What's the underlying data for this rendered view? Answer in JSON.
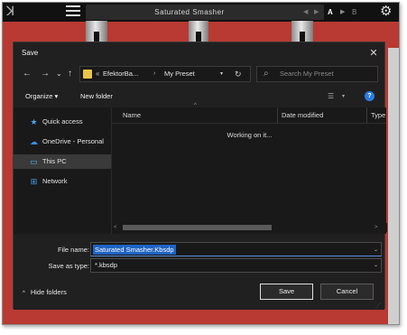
{
  "plugin": {
    "logo": "ꓘ",
    "preset_name": "Saturated Smasher",
    "prev_arrow": "◀",
    "next_arrow": "▶",
    "ab_a": "A",
    "ab_arrow": "▶",
    "ab_b": "B",
    "accent_color": "#b83a32"
  },
  "dialog": {
    "title": "Save",
    "close": "✕",
    "nav": {
      "back": "←",
      "forward": "→",
      "recent": "⌄",
      "up": "↑",
      "breadcrumb_sep0": "«",
      "breadcrumb": [
        "EfektorBa...",
        "My Preset"
      ],
      "breadcrumb_sep": "›",
      "path_dropdown": "▾",
      "refresh": "↻",
      "search_icon": "⌕",
      "search_placeholder": "Search My Preset"
    },
    "toolbar": {
      "organize": "Organize ▾",
      "new_folder": "New folder",
      "view_icon": "☰",
      "view_dropdown": "▾",
      "help": "?"
    },
    "nav_pane": [
      {
        "label": "Quick access",
        "icon": "star-icon",
        "glyph": "★",
        "color": "#4aa3f0"
      },
      {
        "label": "OneDrive - Personal",
        "icon": "cloud-icon",
        "glyph": "☁",
        "color": "#3a8ee6"
      },
      {
        "label": "This PC",
        "icon": "computer-icon",
        "glyph": "▭",
        "color": "#5fb0e8"
      },
      {
        "label": "Network",
        "icon": "network-icon",
        "glyph": "⊞",
        "color": "#4aa3f0"
      }
    ],
    "list": {
      "sort_arrow": "^",
      "columns": [
        "Name",
        "Date modified",
        "Type"
      ],
      "status": "Working on it..."
    },
    "scroll": {
      "left": "<",
      "right": ">"
    },
    "form": {
      "file_name_label": "File name:",
      "file_name_value": "Saturated Smasher.Kbsdp",
      "save_type_label": "Save as type:",
      "save_type_value": "*.kbsdp",
      "dropdown": "⌄"
    },
    "footer": {
      "hide_folders": "Hide folders",
      "hide_arrow": "^",
      "save": "Save",
      "cancel": "Cancel"
    }
  }
}
